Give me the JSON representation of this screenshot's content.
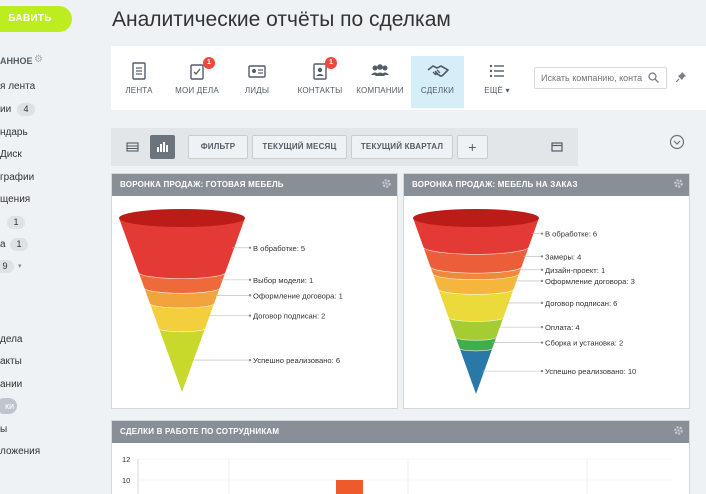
{
  "page": {
    "title": "Аналитические отчёты по сделкам"
  },
  "sidebar": {
    "add_button": "БАВИТЬ",
    "favorites_label": "АННОЕ",
    "items": [
      {
        "label": "я лента"
      },
      {
        "label": "ии",
        "badge": "4"
      },
      {
        "label": "ндарь"
      },
      {
        "label": "Диск"
      },
      {
        "label": "графии"
      },
      {
        "label": "щения"
      },
      {
        "label": "",
        "badge": "1"
      },
      {
        "label": "а",
        "badge": "1"
      },
      {
        "label": "",
        "badge": "9"
      },
      {
        "label": ""
      },
      {
        "label": "дела"
      },
      {
        "label": "акты"
      },
      {
        "label": "ании"
      },
      {
        "label": "ки",
        "selected": true
      },
      {
        "label": "ы"
      },
      {
        "label": "ложения"
      }
    ]
  },
  "toolbar": {
    "tabs": [
      {
        "label": "ЛЕНТА",
        "icon": "feed-icon"
      },
      {
        "label": "МОИ ДЕЛА",
        "icon": "tasks-icon",
        "badge": "1"
      },
      {
        "label": "ЛИДЫ",
        "icon": "leads-icon"
      },
      {
        "label": "КОНТАКТЫ",
        "icon": "contacts-icon",
        "badge": "1"
      },
      {
        "label": "КОМПАНИИ",
        "icon": "companies-icon"
      },
      {
        "label": "СДЕЛКИ",
        "icon": "handshake-icon",
        "active": true
      },
      {
        "label": "ЕЩЁ",
        "icon": "list-icon",
        "dropdown": true
      }
    ],
    "search_placeholder": "Искать компанию, конта"
  },
  "filters": {
    "filter_label": "ФИЛЬТР",
    "current_month": "ТЕКУЩИЙ МЕСЯЦ",
    "current_quarter": "ТЕКУЩИЙ КВАРТАЛ",
    "add": "+"
  },
  "colors": {
    "accent": "#bbed21",
    "active_tab": "#d6eef8",
    "panel_header": "#888f96",
    "badge_red": "#f0483e"
  },
  "chart_data": [
    {
      "type": "funnel",
      "title": "ВОРОНКА ПРОДАЖ: ГОТОВАЯ МЕБЕЛЬ",
      "stages": [
        {
          "name": "В обработке",
          "value": 5,
          "color": "#e43a36"
        },
        {
          "name": "Выбор модели",
          "value": 1,
          "color": "#ef6a3a"
        },
        {
          "name": "Оформление договора",
          "value": 1,
          "color": "#f2a33c"
        },
        {
          "name": "Договор подписан",
          "value": 2,
          "color": "#f4cf3d"
        },
        {
          "name": "Успешно реализовано",
          "value": 6,
          "color": "#c9d92c"
        }
      ]
    },
    {
      "type": "funnel",
      "title": "ВОРОНКА ПРОДАЖ: МЕБЕЛЬ НА ЗАКАЗ",
      "stages": [
        {
          "name": "В обработке",
          "value": 6,
          "color": "#e43a36"
        },
        {
          "name": "Замеры",
          "value": 4,
          "color": "#ec5e3a"
        },
        {
          "name": "Дизайн-проект",
          "value": 1,
          "color": "#f08a3b"
        },
        {
          "name": "Оформление договора",
          "value": 3,
          "color": "#f4b63c"
        },
        {
          "name": "Договор подписан",
          "value": 6,
          "color": "#ecd93a"
        },
        {
          "name": "Оплата",
          "value": 4,
          "color": "#a5cc33"
        },
        {
          "name": "Сборка и установка",
          "value": 2,
          "color": "#3fae4d"
        },
        {
          "name": "Успешно реализовано",
          "value": 10,
          "color": "#2a78a8"
        }
      ]
    },
    {
      "type": "bar",
      "title": "СДЕЛКИ В РАБОТЕ ПО СОТРУДНИКАМ",
      "y_ticks": [
        "12",
        "10"
      ],
      "ylim": [
        0,
        12
      ],
      "visible_bars": [
        {
          "value": 10,
          "color": "#ef5a2c"
        }
      ]
    }
  ]
}
